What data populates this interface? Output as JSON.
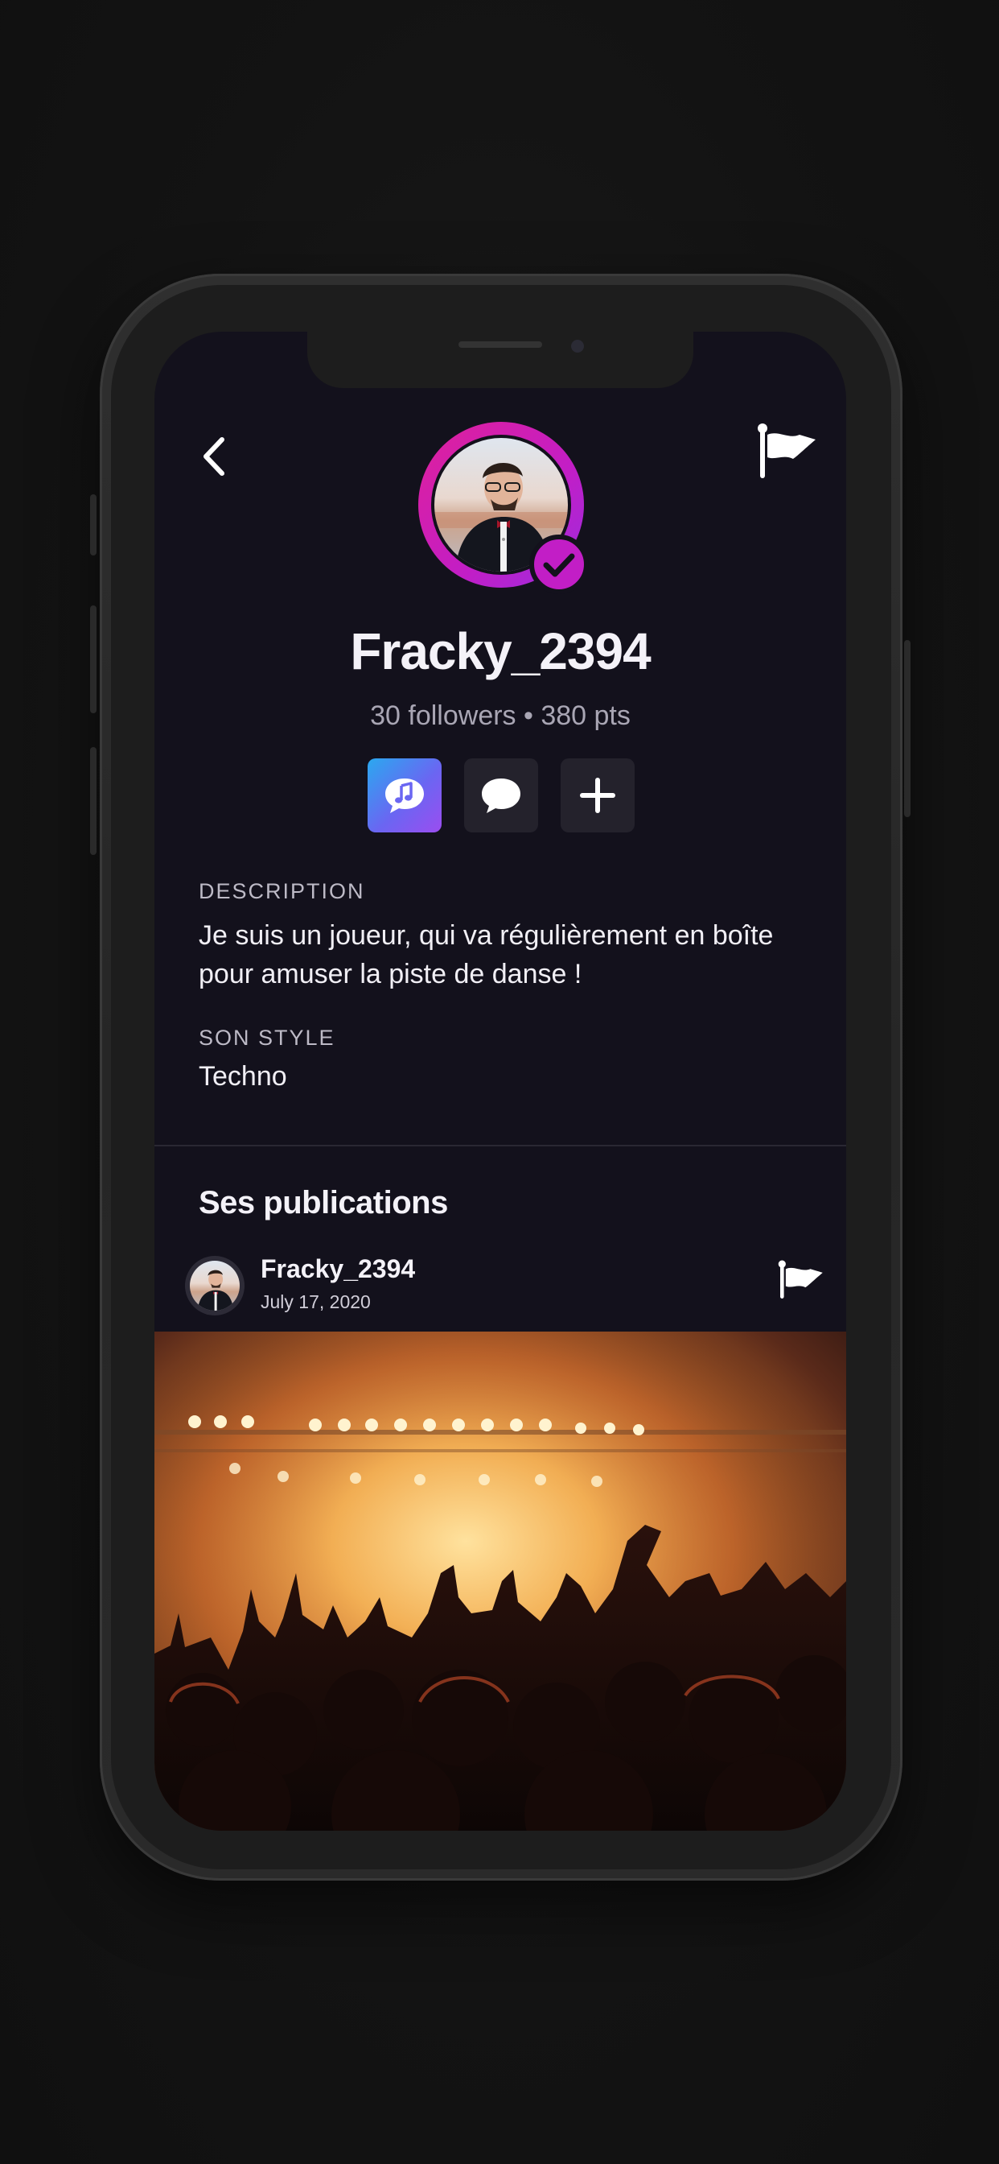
{
  "profile": {
    "username": "Fracky_2394",
    "stats": "30 followers • 380 pts",
    "verified": true
  },
  "actions": [
    {
      "name": "music-chat",
      "icon": "music-chat-icon"
    },
    {
      "name": "message",
      "icon": "chat-bubble-icon"
    },
    {
      "name": "follow",
      "icon": "plus-icon"
    }
  ],
  "about": {
    "description_label": "DESCRIPTION",
    "description": "Je suis un joueur, qui va régulièrement en boîte pour amuser la piste de danse !",
    "style_label": "SON STYLE",
    "style": "Techno"
  },
  "publications": {
    "title": "Ses publications",
    "posts": [
      {
        "author": "Fracky_2394",
        "date": "July 17, 2020"
      }
    ]
  },
  "colors": {
    "screen_bg": "#13111c",
    "accent_pink": "#c21ec6",
    "accent_blue": "#2aa9f0",
    "button_bg": "#24222c"
  }
}
